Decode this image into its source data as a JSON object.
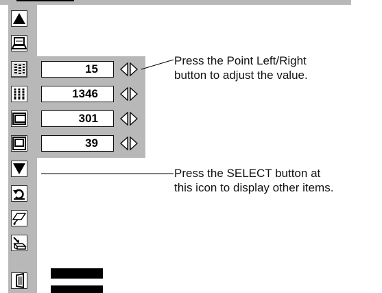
{
  "annotations": {
    "value_note_line1": "Press the Point Left/Right",
    "value_note_line2": "button to adjust the value.",
    "select_note_line1": "Press the SELECT button at",
    "select_note_line2": "this icon to display other items."
  },
  "values": [
    {
      "name": "value-1",
      "value": "15"
    },
    {
      "name": "value-2",
      "value": "1346"
    },
    {
      "name": "value-3",
      "value": "301"
    },
    {
      "name": "value-4",
      "value": "39"
    }
  ],
  "icons": [
    "up-arrow-icon",
    "monitor-icon",
    "fine-sync-icon",
    "total-dots-icon",
    "horizontal-position-icon",
    "vertical-position-icon",
    "down-arrow-icon",
    "reset-icon",
    "mode-icon",
    "store-icon",
    "quit-icon"
  ]
}
